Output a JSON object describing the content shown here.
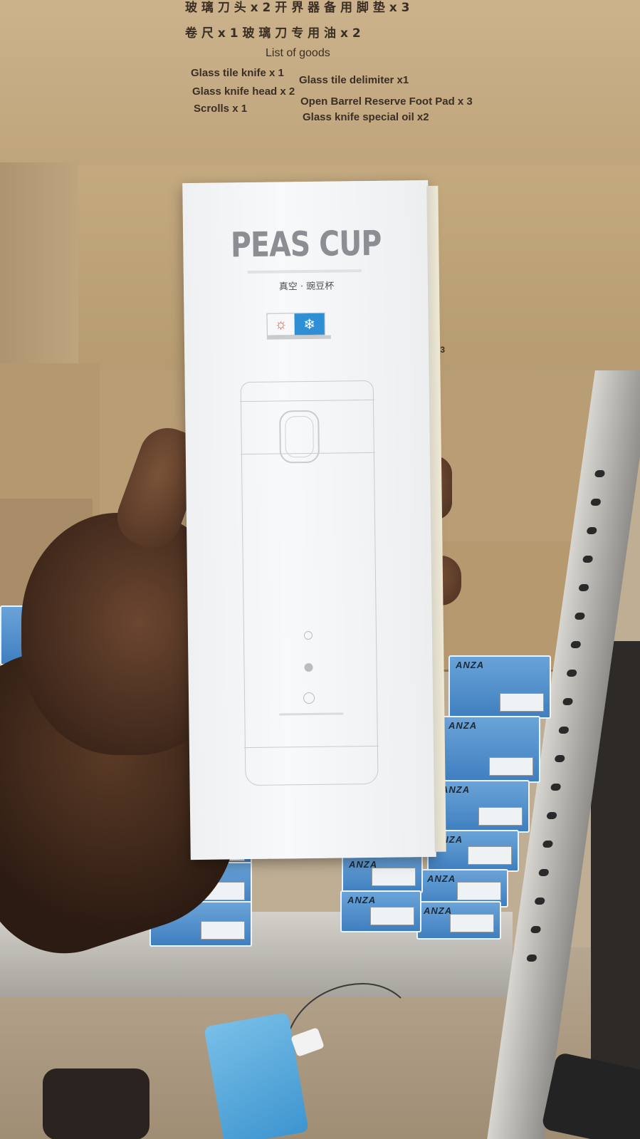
{
  "carton_label": {
    "cn_line1": "玻 璃 刀 头 x 2  开 界 器 备 用 脚 垫  x 3",
    "cn_line2": "卷        尺 x 1  玻 璃 刀 专 用 油  x 2",
    "heading": "List of goods",
    "items": [
      "Glass tile knife x 1",
      "Glass tile delimiter x1",
      "Glass knife head x 2",
      "Open Barrel Reserve Foot Pad x 3",
      "Scrolls x 1",
      "Glass knife special oil x2"
    ],
    "partial_right_1": "Pad x 3",
    "partial_right_2": "x 3"
  },
  "product_box": {
    "title": "PEAS CUP",
    "subtitle": "真空 · 豌豆杯",
    "hot_icon": "sun-icon",
    "cold_icon": "snowflake-icon",
    "colors": {
      "box": "#f4f5f6",
      "title": "#8b8f93",
      "cold_badge": "#2f8fd4",
      "hot_icon": "#d05a4a"
    }
  },
  "blue_boxes": {
    "brand": "ANZA",
    "colors": {
      "box": "#5b97d1"
    }
  }
}
